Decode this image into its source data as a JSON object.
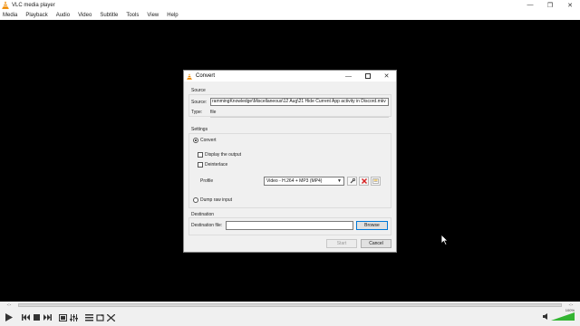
{
  "app": {
    "title": "VLC media player",
    "window_controls": [
      "—",
      "❐",
      "✕"
    ]
  },
  "menu": [
    "Media",
    "Playback",
    "Audio",
    "Video",
    "Subtitle",
    "Tools",
    "View",
    "Help"
  ],
  "player": {
    "time_elapsed": "-:-",
    "time_total": "-:-",
    "volume": "100%",
    "volume_level": 1.0
  },
  "dialog": {
    "title": "Convert",
    "source_group": "Source",
    "source_label": "Source:",
    "source_value": "rammingKnowledge\\Miscellaneous\\12 Aug\\21 Hide Current App activity in Discord.mkv",
    "type_label": "Type:",
    "type_value": "file",
    "settings_group": "Settings",
    "convert_option": "Convert",
    "display_output": "Display the output",
    "deinterlace": "Deinterlace",
    "profile_label": "Profile",
    "profile_value": "Video - H.264 + MP3 (MP4)",
    "dump_raw": "Dump raw input",
    "destination_group": "Destination",
    "dest_file_label": "Destination file:",
    "dest_file_value": "",
    "browse": "Browse",
    "start": "Start",
    "cancel": "Cancel"
  },
  "colors": {
    "vlc_orange": "#f08a00",
    "delete_red": "#d62020",
    "focus_blue": "#0078d7",
    "volume_green": "#33b532"
  }
}
